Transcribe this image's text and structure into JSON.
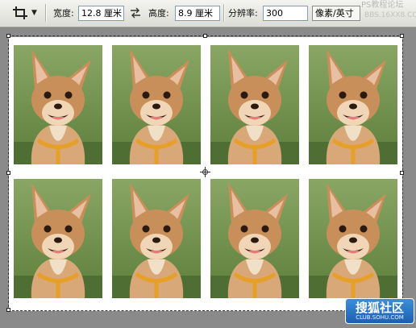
{
  "options_bar": {
    "tool_icon": "crop-icon",
    "dropdown_icon": "chevron-down-icon",
    "width_label": "宽度:",
    "width_value": "12.8 厘米",
    "swap_icon": "swap-arrows-icon",
    "height_label": "高度:",
    "height_value": "8.9 厘米",
    "resolution_label": "分辨率:",
    "resolution_value": "300",
    "resolution_unit": "像素/英寸",
    "watermark_line1": "PS教程论坛",
    "watermark_line2": "BBS.16XX8.COM"
  },
  "canvas": {
    "photo_subject": "chihuahua-dog-photo",
    "photo_count": 8,
    "center_icon": "crosshair-icon"
  },
  "logo": {
    "text": "搜狐社区",
    "sub": "CLUB.SOHU.COM"
  },
  "colors": {
    "grass": "#6e8f4a",
    "dog_fur": "#c98f5a",
    "logo_blue": "#2a74c8"
  }
}
